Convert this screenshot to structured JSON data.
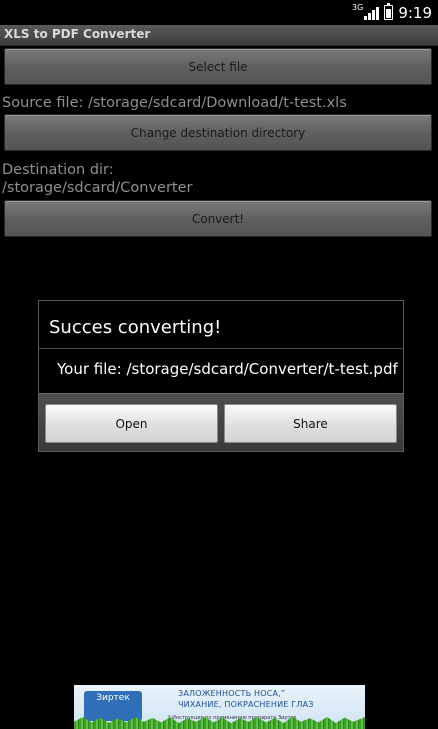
{
  "status_bar": {
    "network": "3G",
    "time": "9:19"
  },
  "app": {
    "title": "XLS to PDF Converter"
  },
  "main": {
    "select_file_label": "Select file",
    "source_file_text": "Source file: /storage/sdcard/Download/t-test.xls",
    "change_dest_label": "Change destination directory",
    "dest_dir_line1": "Destination dir:",
    "dest_dir_line2": "/storage/sdcard/Converter",
    "convert_label": "Convert!"
  },
  "dialog": {
    "title": "Succes converting!",
    "message": "Your file: /storage/sdcard/Converter/t-test.pdf",
    "open_label": "Open",
    "share_label": "Share"
  },
  "ad": {
    "brand": "Зиртек",
    "line1": "ЗАЛОЖЕННОСТЬ НОСА,”",
    "line2": "ЧИХАНИЕ, ПОКРАСНЕНИЕ ГЛАЗ",
    "note": "* Инструкция по применению препарата Зиртек"
  },
  "colors": {
    "background": "#000000",
    "button": "#6a6a6a",
    "dialog_button": "#e8e8e8",
    "label_text": "#8f8f8f"
  }
}
